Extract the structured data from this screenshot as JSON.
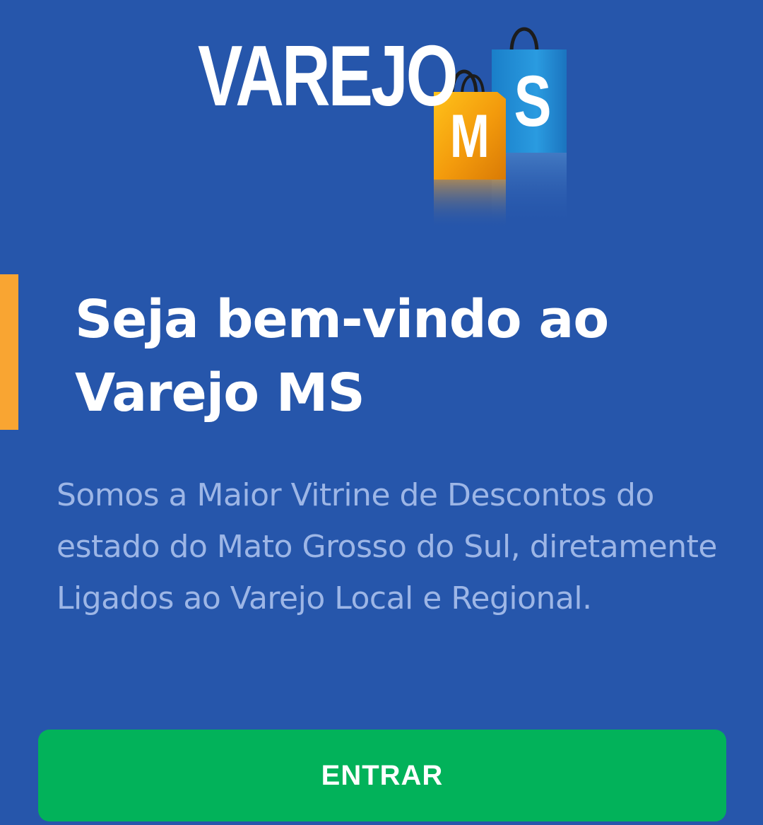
{
  "logo": {
    "wordmark": "VAREJO",
    "bag_letter_blue": "S",
    "bag_letter_orange": "M"
  },
  "hero": {
    "title": "Seja bem-vindo ao Varejo MS",
    "description": "Somos a Maior Vitrine de Descontos do estado do Mato Grosso do Sul, diretamente Ligados ao Varejo Local e Regional."
  },
  "actions": {
    "enter_label": "ENTRAR"
  },
  "colors": {
    "background": "#2656ab",
    "accent": "#f9a532",
    "button": "#02b25a",
    "description_text": "#9db6e6"
  },
  "icons": [
    "shopping-bag-blue-icon",
    "shopping-bag-orange-icon"
  ]
}
